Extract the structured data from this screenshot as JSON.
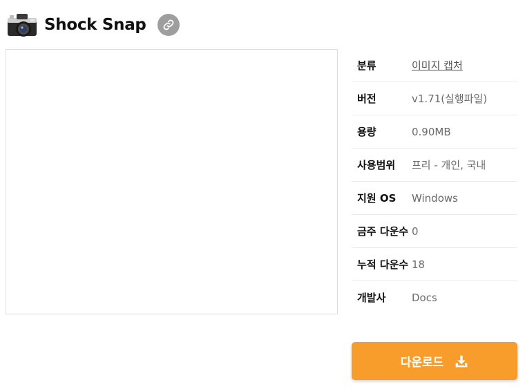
{
  "app": {
    "title": "Shock Snap",
    "icon": "camera-icon",
    "link_icon": "link-icon"
  },
  "info": {
    "rows": [
      {
        "label": "분류",
        "value": "이미지 캡처",
        "is_link": true
      },
      {
        "label": "버전",
        "value": "v1.71(실행파일)",
        "is_link": false
      },
      {
        "label": "용량",
        "value": "0.90MB",
        "is_link": false
      },
      {
        "label": "사용범위",
        "value": "프리 - 개인, 국내",
        "is_link": false
      },
      {
        "label": "지원 OS",
        "value": "Windows",
        "is_link": false
      },
      {
        "label": "금주 다운수",
        "value": "0",
        "is_link": false
      },
      {
        "label": "누적 다운수",
        "value": "18",
        "is_link": false
      },
      {
        "label": "개발사",
        "value": "Docs",
        "is_link": false
      }
    ]
  },
  "download": {
    "label": "다운로드",
    "icon": "download-icon"
  },
  "colors": {
    "accent": "#f89c2c",
    "link_button": "#9e9e9e",
    "border": "#dcdcdc"
  }
}
